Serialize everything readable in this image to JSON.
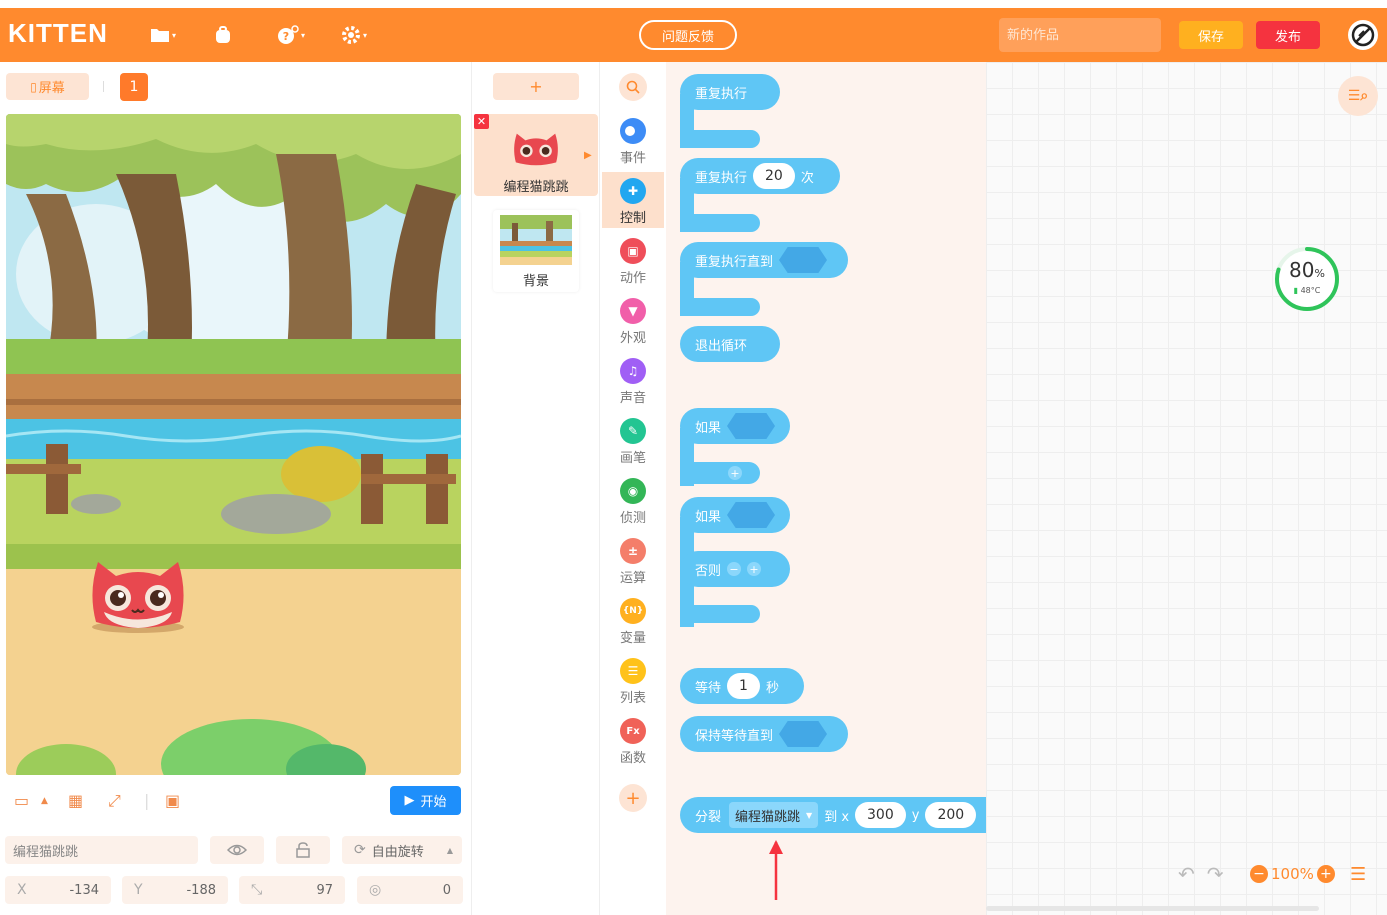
{
  "colors": {
    "brand": "#ff8a2e",
    "block_control": "#5fc6f5",
    "publish": "#f5333f",
    "save": "#ffb01f",
    "start": "#1e8ffb"
  },
  "header": {
    "logo": "KITTEN",
    "feedback_label": "问题反馈",
    "title_placeholder": "新的作品",
    "save_label": "保存",
    "publish_label": "发布",
    "icons": [
      "folder-icon",
      "backpack-icon",
      "help-icon",
      "settings-icon",
      "user-avatar-icon"
    ]
  },
  "stage_panel": {
    "screen_label": "屏幕",
    "page_number": "1",
    "start_label": "开始",
    "sprite_name_value": "编程猫跳跳",
    "rotation_label": "自由旋转",
    "x_label": "X",
    "x_value": "-134",
    "y_label": "Y",
    "y_value": "-188",
    "size_value": "97",
    "direction_value": "0"
  },
  "sprites": {
    "add_label": "+",
    "items": [
      {
        "name": "编程猫跳跳",
        "selected": true
      },
      {
        "name": "背景",
        "selected": false
      }
    ]
  },
  "categories": [
    {
      "label": "事件",
      "color": "#3d8cf6",
      "icon": "toggle-icon"
    },
    {
      "label": "控制",
      "color": "#22a7f0",
      "icon": "gamepad-icon",
      "active": true
    },
    {
      "label": "动作",
      "color": "#ef4e5a",
      "icon": "robot-icon"
    },
    {
      "label": "外观",
      "color": "#f15fa9",
      "icon": "shirt-icon"
    },
    {
      "label": "声音",
      "color": "#a05ff5",
      "icon": "music-icon"
    },
    {
      "label": "画笔",
      "color": "#23c592",
      "icon": "brush-icon"
    },
    {
      "label": "侦测",
      "color": "#33b657",
      "icon": "target-icon"
    },
    {
      "label": "运算",
      "color": "#f47e6a",
      "icon": "math-icon"
    },
    {
      "label": "变量",
      "color": "#ffb01f",
      "icon": "variable-icon"
    },
    {
      "label": "列表",
      "color": "#ffc21a",
      "icon": "list-icon"
    },
    {
      "label": "函数",
      "color": "#f06258",
      "icon": "function-icon"
    }
  ],
  "blocks": {
    "repeat_forever": "重复执行",
    "repeat_times": "重复执行",
    "repeat_times_value": "20",
    "repeat_times_unit": "次",
    "repeat_until": "重复执行直到",
    "break_loop": "退出循环",
    "if_label": "如果",
    "if_else_label": "如果",
    "else_label": "否则",
    "wait_label": "等待",
    "wait_value": "1",
    "wait_unit": "秒",
    "wait_until": "保持等待直到",
    "clone_label": "分裂",
    "clone_target": "编程猫跳跳",
    "clone_to_x": "到 x",
    "clone_x_value": "300",
    "clone_y_label": "y",
    "clone_y_value": "200"
  },
  "workspace": {
    "gauge_value": "80",
    "gauge_unit": "%",
    "gauge_temp": "48°C",
    "gauge_fraction": 0.8,
    "zoom_label": "100%"
  }
}
